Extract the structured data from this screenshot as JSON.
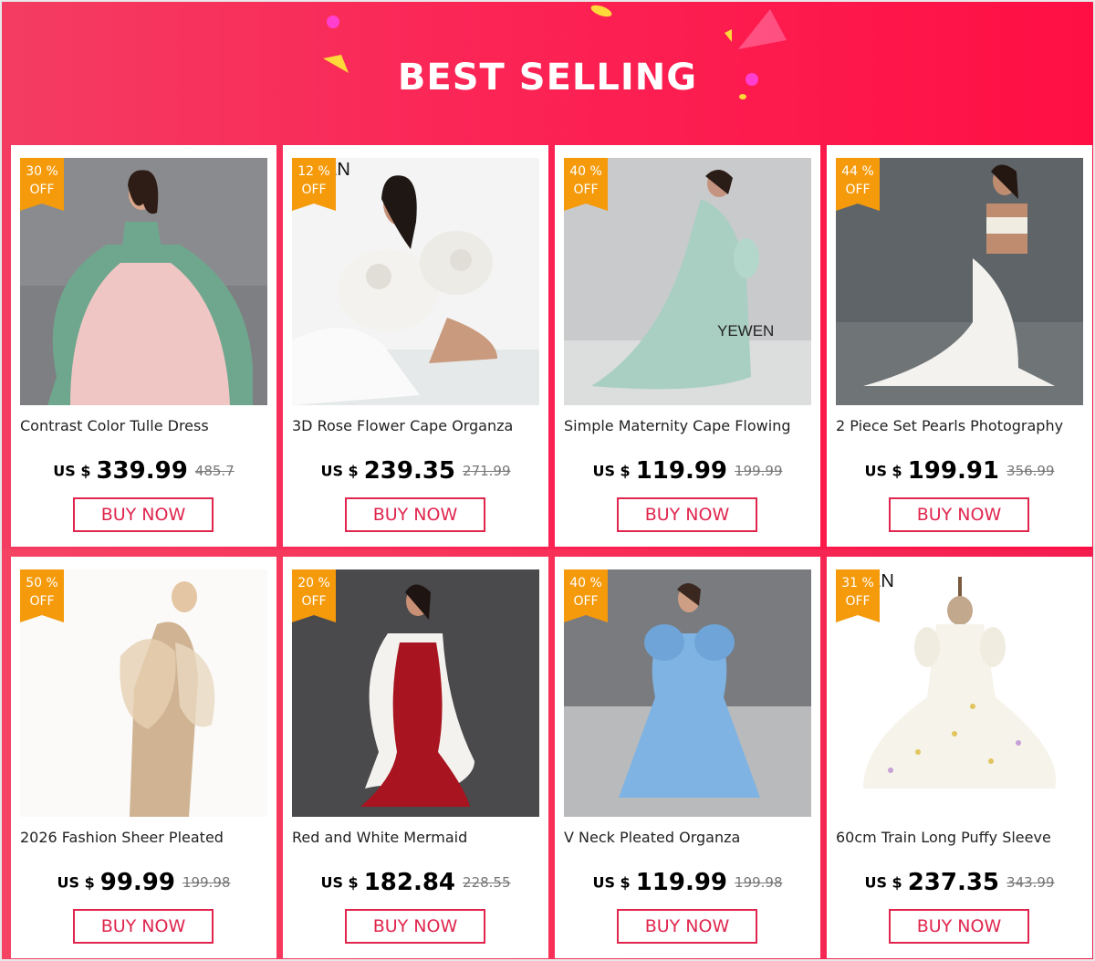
{
  "header": {
    "title": "BEST SELLING"
  },
  "products": [
    {
      "discount_pct": "30 %",
      "discount_label": "OFF",
      "name": "Contrast Color Tulle Dress",
      "currency": "US $",
      "price": "339.99",
      "old_price": "485.7",
      "buy_label": "BUY NOW",
      "brand": ""
    },
    {
      "discount_pct": "12 %",
      "discount_label": "OFF",
      "name": "3D Rose Flower Cape Organza",
      "currency": "US $",
      "price": "239.35",
      "old_price": "271.99",
      "buy_label": "BUY NOW",
      "brand": "EN"
    },
    {
      "discount_pct": "40 %",
      "discount_label": "OFF",
      "name": "Simple Maternity Cape Flowing",
      "currency": "US $",
      "price": "119.99",
      "old_price": "199.99",
      "buy_label": "BUY NOW",
      "brand": "YEWEN"
    },
    {
      "discount_pct": "44 %",
      "discount_label": "OFF",
      "name": "2 Piece Set Pearls Photography",
      "currency": "US $",
      "price": "199.91",
      "old_price": "356.99",
      "buy_label": "BUY NOW",
      "brand": ""
    },
    {
      "discount_pct": "50 %",
      "discount_label": "OFF",
      "name": "2026 Fashion Sheer Pleated",
      "currency": "US $",
      "price": "99.99",
      "old_price": "199.98",
      "buy_label": "BUY NOW",
      "brand": ""
    },
    {
      "discount_pct": "20 %",
      "discount_label": "OFF",
      "name": "Red and White Mermaid",
      "currency": "US $",
      "price": "182.84",
      "old_price": "228.55",
      "buy_label": "BUY NOW",
      "brand": ""
    },
    {
      "discount_pct": "40 %",
      "discount_label": "OFF",
      "name": "V Neck Pleated Organza",
      "currency": "US $",
      "price": "119.99",
      "old_price": "199.98",
      "buy_label": "BUY NOW",
      "brand": ""
    },
    {
      "discount_pct": "31 %",
      "discount_label": "OFF",
      "name": "60cm Train Long Puffy Sleeve",
      "currency": "US $",
      "price": "237.35",
      "old_price": "343.99",
      "buy_label": "BUY NOW",
      "brand": "EN"
    }
  ],
  "colors": {
    "accent": "#e0264e",
    "badge": "#f59a0b",
    "banner": "#fb2455"
  }
}
